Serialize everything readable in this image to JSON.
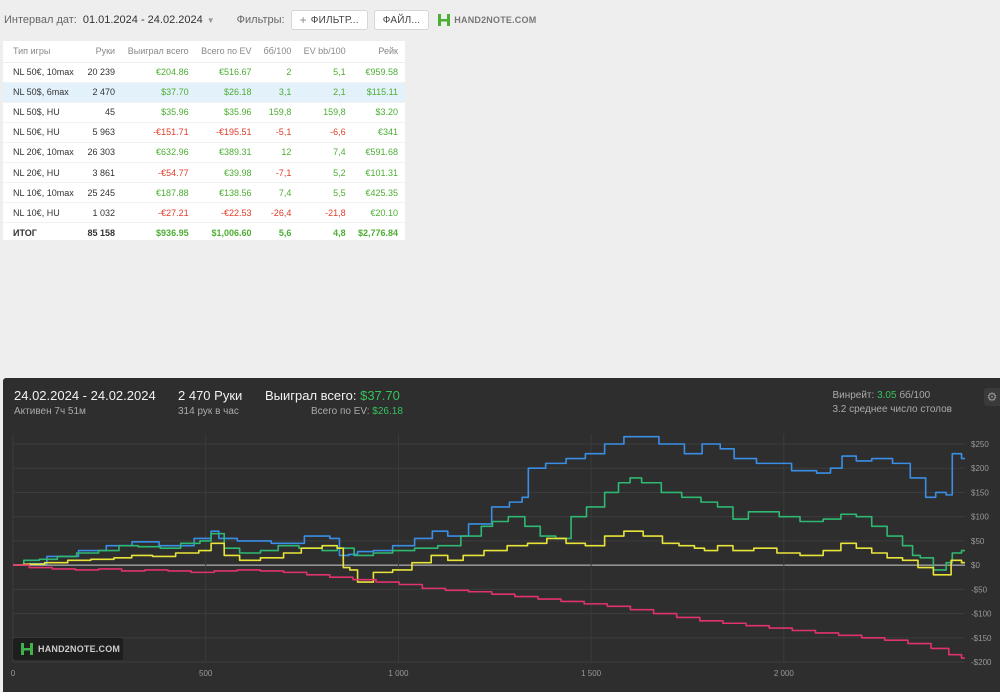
{
  "toolbar": {
    "date_label": "Интервал дат:",
    "date_value": "01.01.2024 - 24.02.2024",
    "filters_label": "Фильтры:",
    "filter_button": "ФИЛЬТР...",
    "files_button": "ФАЙЛ...",
    "logo_text": "HAND2NOTE.COM"
  },
  "table": {
    "columns": [
      "Тип игры",
      "Руки",
      "Выиграл всего",
      "Всего по EV",
      "бб/100",
      "EV bb/100",
      "Рейк"
    ],
    "rows": [
      {
        "game": "NL 50€, 10max",
        "hands": "20 239",
        "won": "€204.86",
        "ev": "€516.67",
        "bb": "2",
        "evbb": "5,1",
        "rake": "€959.58",
        "won_neg": false,
        "ev_neg": false,
        "bb_neg": false,
        "evbb_neg": false
      },
      {
        "game": "NL 50$, 6max",
        "hands": "2 470",
        "won": "$37.70",
        "ev": "$26.18",
        "bb": "3,1",
        "evbb": "2,1",
        "rake": "$115.11",
        "won_neg": false,
        "ev_neg": false,
        "bb_neg": false,
        "evbb_neg": false
      },
      {
        "game": "NL 50$, HU",
        "hands": "45",
        "won": "$35.96",
        "ev": "$35.96",
        "bb": "159,8",
        "evbb": "159,8",
        "rake": "$3.20",
        "won_neg": false,
        "ev_neg": false,
        "bb_neg": false,
        "evbb_neg": false
      },
      {
        "game": "NL 50€, HU",
        "hands": "5 963",
        "won": "-€151.71",
        "ev": "-€195.51",
        "bb": "-5,1",
        "evbb": "-6,6",
        "rake": "€341",
        "won_neg": true,
        "ev_neg": true,
        "bb_neg": true,
        "evbb_neg": true
      },
      {
        "game": "NL 20€, 10max",
        "hands": "26 303",
        "won": "€632.96",
        "ev": "€389.31",
        "bb": "12",
        "evbb": "7,4",
        "rake": "€591.68",
        "won_neg": false,
        "ev_neg": false,
        "bb_neg": false,
        "evbb_neg": false
      },
      {
        "game": "NL 20€, HU",
        "hands": "3 861",
        "won": "-€54.77",
        "ev": "€39.98",
        "bb": "-7,1",
        "evbb": "5,2",
        "rake": "€101.31",
        "won_neg": true,
        "ev_neg": false,
        "bb_neg": true,
        "evbb_neg": false
      },
      {
        "game": "NL 10€, 10max",
        "hands": "25 245",
        "won": "€187.88",
        "ev": "€138.56",
        "bb": "7,4",
        "evbb": "5,5",
        "rake": "€425.35",
        "won_neg": false,
        "ev_neg": false,
        "bb_neg": false,
        "evbb_neg": false
      },
      {
        "game": "NL 10€, HU",
        "hands": "1 032",
        "won": "-€27.21",
        "ev": "-€22.53",
        "bb": "-26,4",
        "evbb": "-21,8",
        "rake": "€20.10",
        "won_neg": true,
        "ev_neg": true,
        "bb_neg": true,
        "evbb_neg": true
      }
    ],
    "total": {
      "game": "ИТОГ",
      "hands": "85 158",
      "won": "$936.95",
      "ev": "$1,006.60",
      "bb": "5,6",
      "evbb": "4,8",
      "rake": "$2,776.84"
    }
  },
  "panel": {
    "date_range": "24.02.2024 - 24.02.2024",
    "active": "Активен 7ч 51м",
    "hands": "2 470 Руки",
    "hands_per_hour": "314 рук в час",
    "won_label": "Выиграл всего:",
    "won_value": "$37.70",
    "ev_label": "Всего по EV:",
    "ev_value": "$26.18",
    "winrate_label": "Винрейт:",
    "winrate_value": "3.05",
    "winrate_unit": "бб/100",
    "tables_text": "3.2 среднее число столов",
    "watermark": "HAND2NOTE.COM"
  },
  "chart_data": {
    "type": "line",
    "x_ticks": [
      "0",
      "500",
      "1 000",
      "1 500",
      "2 000"
    ],
    "x_tick_values": [
      0,
      500,
      1000,
      1500,
      2000
    ],
    "y_ticks": [
      "$250",
      "$200",
      "$150",
      "$100",
      "$50",
      "$0",
      "-$50",
      "-$100",
      "-$150",
      "-$200"
    ],
    "y_tick_values": [
      250,
      200,
      150,
      100,
      50,
      0,
      -50,
      -100,
      -150,
      -200
    ],
    "xlim": [
      0,
      2470
    ],
    "ylim": [
      -200,
      250
    ],
    "colors": {
      "blue": "#3a8ee6",
      "green": "#2eb872",
      "yellow": "#e8e43a",
      "pink": "#e0326e",
      "zero": "#cfcfcf"
    },
    "series": [
      {
        "color_key": "blue",
        "points": [
          [
            0,
            0
          ],
          [
            60,
            3
          ],
          [
            100,
            18
          ],
          [
            200,
            30
          ],
          [
            260,
            40
          ],
          [
            330,
            48
          ],
          [
            400,
            40
          ],
          [
            500,
            55
          ],
          [
            520,
            70
          ],
          [
            540,
            55
          ],
          [
            600,
            50
          ],
          [
            700,
            45
          ],
          [
            780,
            60
          ],
          [
            840,
            55
          ],
          [
            850,
            20
          ],
          [
            880,
            22
          ],
          [
            900,
            28
          ],
          [
            950,
            30
          ],
          [
            1000,
            40
          ],
          [
            1060,
            55
          ],
          [
            1100,
            70
          ],
          [
            1140,
            60
          ],
          [
            1200,
            85
          ],
          [
            1260,
            120
          ],
          [
            1300,
            130
          ],
          [
            1330,
            140
          ],
          [
            1340,
            200
          ],
          [
            1400,
            210
          ],
          [
            1450,
            220
          ],
          [
            1500,
            230
          ],
          [
            1550,
            250
          ],
          [
            1600,
            265
          ],
          [
            1620,
            265
          ],
          [
            1700,
            250
          ],
          [
            1760,
            230
          ],
          [
            1800,
            250
          ],
          [
            1850,
            240
          ],
          [
            1880,
            220
          ],
          [
            1950,
            210
          ],
          [
            2050,
            195
          ],
          [
            2100,
            190
          ],
          [
            2130,
            200
          ],
          [
            2160,
            225
          ],
          [
            2200,
            215
          ],
          [
            2240,
            220
          ],
          [
            2300,
            210
          ],
          [
            2340,
            180
          ],
          [
            2380,
            140
          ],
          [
            2400,
            150
          ],
          [
            2430,
            145
          ],
          [
            2440,
            230
          ],
          [
            2470,
            220
          ]
        ]
      },
      {
        "color_key": "green",
        "points": [
          [
            0,
            0
          ],
          [
            40,
            10
          ],
          [
            80,
            12
          ],
          [
            130,
            18
          ],
          [
            180,
            25
          ],
          [
            240,
            30
          ],
          [
            290,
            40
          ],
          [
            340,
            38
          ],
          [
            400,
            35
          ],
          [
            450,
            45
          ],
          [
            500,
            50
          ],
          [
            520,
            65
          ],
          [
            560,
            35
          ],
          [
            600,
            25
          ],
          [
            660,
            30
          ],
          [
            700,
            40
          ],
          [
            760,
            35
          ],
          [
            820,
            30
          ],
          [
            850,
            35
          ],
          [
            900,
            20
          ],
          [
            950,
            25
          ],
          [
            1000,
            30
          ],
          [
            1060,
            35
          ],
          [
            1120,
            40
          ],
          [
            1180,
            60
          ],
          [
            1230,
            80
          ],
          [
            1250,
            90
          ],
          [
            1300,
            100
          ],
          [
            1340,
            80
          ],
          [
            1380,
            60
          ],
          [
            1420,
            55
          ],
          [
            1460,
            100
          ],
          [
            1500,
            120
          ],
          [
            1550,
            150
          ],
          [
            1580,
            170
          ],
          [
            1610,
            180
          ],
          [
            1640,
            170
          ],
          [
            1700,
            150
          ],
          [
            1750,
            140
          ],
          [
            1800,
            130
          ],
          [
            1840,
            120
          ],
          [
            1880,
            95
          ],
          [
            1920,
            110
          ],
          [
            1960,
            110
          ],
          [
            2000,
            100
          ],
          [
            2060,
            90
          ],
          [
            2120,
            95
          ],
          [
            2160,
            105
          ],
          [
            2200,
            100
          ],
          [
            2240,
            80
          ],
          [
            2280,
            60
          ],
          [
            2320,
            40
          ],
          [
            2340,
            20
          ],
          [
            2360,
            15
          ],
          [
            2400,
            -10
          ],
          [
            2430,
            5
          ],
          [
            2440,
            25
          ],
          [
            2470,
            30
          ]
        ]
      },
      {
        "color_key": "yellow",
        "points": [
          [
            0,
            0
          ],
          [
            40,
            2
          ],
          [
            100,
            5
          ],
          [
            160,
            10
          ],
          [
            220,
            12
          ],
          [
            280,
            15
          ],
          [
            320,
            20
          ],
          [
            380,
            18
          ],
          [
            440,
            25
          ],
          [
            500,
            30
          ],
          [
            520,
            45
          ],
          [
            560,
            20
          ],
          [
            600,
            10
          ],
          [
            660,
            15
          ],
          [
            720,
            25
          ],
          [
            760,
            35
          ],
          [
            820,
            40
          ],
          [
            850,
            35
          ],
          [
            860,
            -5
          ],
          [
            880,
            -10
          ],
          [
            900,
            -35
          ],
          [
            950,
            -15
          ],
          [
            1000,
            -10
          ],
          [
            1050,
            5
          ],
          [
            1100,
            20
          ],
          [
            1140,
            10
          ],
          [
            1180,
            20
          ],
          [
            1240,
            30
          ],
          [
            1300,
            40
          ],
          [
            1350,
            45
          ],
          [
            1400,
            55
          ],
          [
            1450,
            45
          ],
          [
            1500,
            40
          ],
          [
            1550,
            60
          ],
          [
            1600,
            70
          ],
          [
            1650,
            60
          ],
          [
            1700,
            45
          ],
          [
            1740,
            40
          ],
          [
            1780,
            35
          ],
          [
            1800,
            30
          ],
          [
            1840,
            40
          ],
          [
            1880,
            30
          ],
          [
            1940,
            35
          ],
          [
            2000,
            25
          ],
          [
            2060,
            20
          ],
          [
            2120,
            30
          ],
          [
            2160,
            45
          ],
          [
            2200,
            35
          ],
          [
            2240,
            25
          ],
          [
            2280,
            15
          ],
          [
            2320,
            10
          ],
          [
            2360,
            -5
          ],
          [
            2400,
            -20
          ],
          [
            2420,
            -20
          ],
          [
            2440,
            10
          ],
          [
            2470,
            5
          ]
        ]
      },
      {
        "color_key": "pink",
        "points": [
          [
            0,
            0
          ],
          [
            60,
            -5
          ],
          [
            120,
            -8
          ],
          [
            180,
            -10
          ],
          [
            240,
            -8
          ],
          [
            300,
            -12
          ],
          [
            360,
            -10
          ],
          [
            420,
            -12
          ],
          [
            480,
            -15
          ],
          [
            540,
            -12
          ],
          [
            600,
            -10
          ],
          [
            660,
            -12
          ],
          [
            720,
            -15
          ],
          [
            780,
            -20
          ],
          [
            840,
            -25
          ],
          [
            900,
            -30
          ],
          [
            960,
            -35
          ],
          [
            1020,
            -40
          ],
          [
            1080,
            -48
          ],
          [
            1140,
            -52
          ],
          [
            1200,
            -55
          ],
          [
            1260,
            -60
          ],
          [
            1320,
            -65
          ],
          [
            1380,
            -70
          ],
          [
            1440,
            -75
          ],
          [
            1500,
            -80
          ],
          [
            1560,
            -85
          ],
          [
            1620,
            -92
          ],
          [
            1680,
            -100
          ],
          [
            1740,
            -108
          ],
          [
            1800,
            -115
          ],
          [
            1860,
            -120
          ],
          [
            1920,
            -125
          ],
          [
            1980,
            -130
          ],
          [
            2040,
            -135
          ],
          [
            2100,
            -140
          ],
          [
            2160,
            -145
          ],
          [
            2220,
            -150
          ],
          [
            2280,
            -155
          ],
          [
            2340,
            -162
          ],
          [
            2400,
            -172
          ],
          [
            2440,
            -185
          ],
          [
            2470,
            -192
          ]
        ]
      }
    ]
  }
}
